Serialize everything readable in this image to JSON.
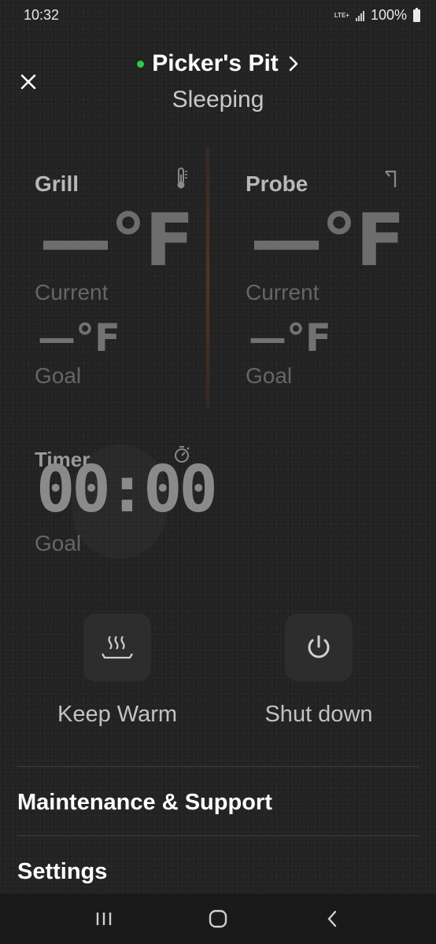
{
  "status_bar": {
    "time": "10:32",
    "network": "LTE+",
    "battery": "100%"
  },
  "header": {
    "title": "Picker's Pit",
    "subtitle": "Sleeping",
    "online_color": "#2ec84a"
  },
  "grill": {
    "label": "Grill",
    "current": "—°F",
    "current_label": "Current",
    "goal": "—°F",
    "goal_label": "Goal",
    "icon": "thermometer-icon"
  },
  "probe": {
    "label": "Probe",
    "current": "—°F",
    "current_label": "Current",
    "goal": "—°F",
    "goal_label": "Goal",
    "icon": "probe-icon"
  },
  "timer": {
    "label": "Timer",
    "value": "00:00",
    "goal_label": "Goal",
    "icon": "stopwatch-icon"
  },
  "actions": {
    "keep_warm": "Keep Warm",
    "shut_down": "Shut down"
  },
  "menu": {
    "maintenance": "Maintenance & Support",
    "settings": "Settings"
  }
}
